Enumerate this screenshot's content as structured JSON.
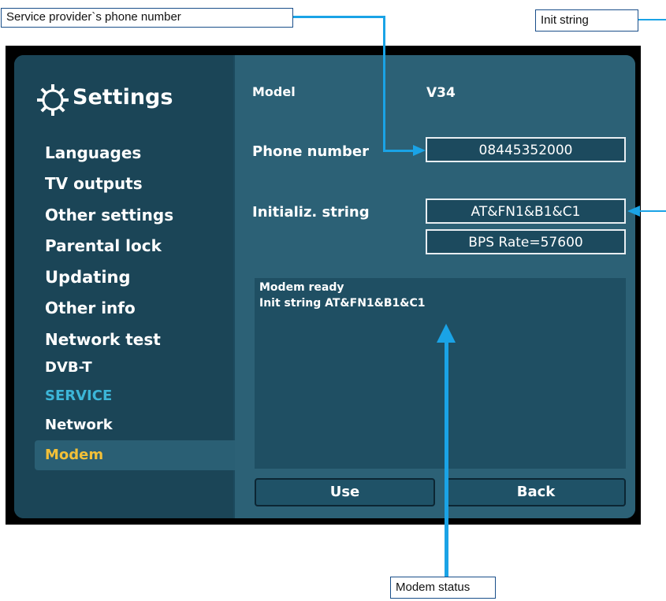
{
  "annotations": {
    "phone": "Service provider`s phone number",
    "init": "Init string",
    "status": "Modem status"
  },
  "sidebar": {
    "title": "Settings",
    "items": [
      {
        "label": "Languages"
      },
      {
        "label": "TV outputs"
      },
      {
        "label": "Other settings"
      },
      {
        "label": "Parental lock"
      },
      {
        "label": "Updating"
      },
      {
        "label": "Other info"
      },
      {
        "label": "Network test"
      },
      {
        "label": "DVB-T"
      },
      {
        "label": "SERVICE"
      },
      {
        "label": "Network"
      },
      {
        "label": "Modem"
      }
    ],
    "active": "Modem"
  },
  "main": {
    "model_label": "Model",
    "model_value": "V34",
    "phone_label": "Phone number",
    "phone_value": "08445352000",
    "init_label": "Initializ. string",
    "init_value": "AT&FN1&B1&C1",
    "bps_value": "BPS Rate=57600",
    "status_lines": [
      "Modem ready",
      "Init string AT&FN1&B1&C1"
    ],
    "use_label": "Use",
    "back_label": "Back"
  },
  "colors": {
    "panel": "#1c4a5e",
    "active_item": "#f2c038",
    "service_heading": "#3cb6d8",
    "callout_line": "#1aa3e6"
  }
}
